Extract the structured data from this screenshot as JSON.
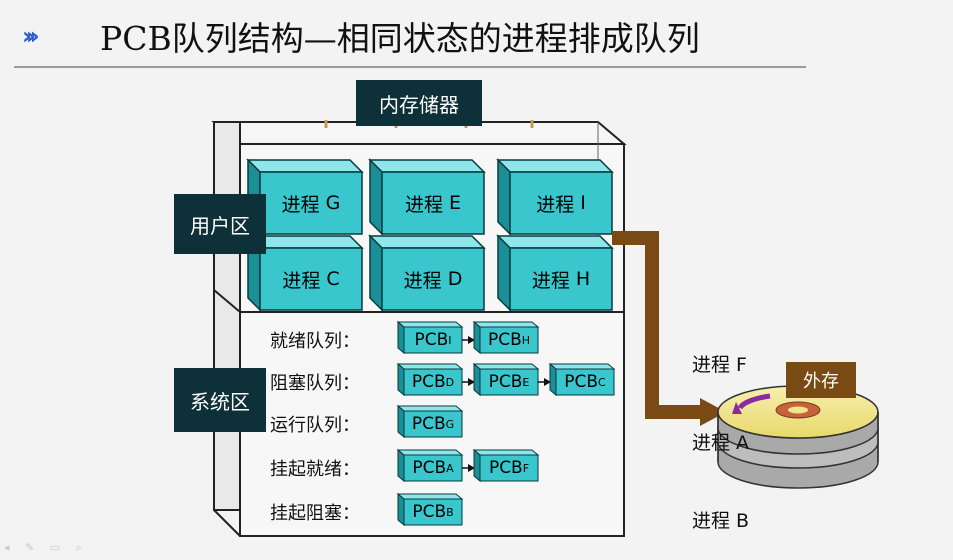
{
  "title": "PCB队列结构—相同状态的进程排成队列",
  "chevron_glyph": "›››",
  "memory_label": "内存储器",
  "user_area_label": "用户区",
  "system_area_label": "系统区",
  "processes": [
    {
      "name": "进程",
      "id": "G"
    },
    {
      "name": "进程",
      "id": "E"
    },
    {
      "name": "进程",
      "id": "I"
    },
    {
      "name": "进程",
      "id": "C"
    },
    {
      "name": "进程",
      "id": "D"
    },
    {
      "name": "进程",
      "id": "H"
    }
  ],
  "queues": [
    {
      "label": "就绪队列：",
      "pcbs": [
        {
          "text": "PCB",
          "sub": "I"
        },
        {
          "text": "PCB",
          "sub": "H"
        }
      ]
    },
    {
      "label": "阻塞队列：",
      "pcbs": [
        {
          "text": "PCB",
          "sub": "D"
        },
        {
          "text": "PCB",
          "sub": "E"
        },
        {
          "text": "PCB",
          "sub": "C"
        }
      ]
    },
    {
      "label": "运行队列：",
      "pcbs": [
        {
          "text": "PCB",
          "sub": "G"
        }
      ]
    },
    {
      "label": "挂起就绪：",
      "pcbs": [
        {
          "text": "PCB",
          "sub": "A"
        },
        {
          "text": "PCB",
          "sub": "F"
        }
      ]
    },
    {
      "label": "挂起阻塞：",
      "pcbs": [
        {
          "text": "PCB",
          "sub": "B"
        }
      ]
    }
  ],
  "external_processes": [
    "进程 F",
    "进程 A",
    "进程 B"
  ],
  "external_storage_label": "外存",
  "colors": {
    "cube_front": "#39c6cc",
    "cube_top": "#8ee6ea",
    "cube_side": "#1b8f96",
    "dark_label": "#0e3038",
    "arrow": "#7a4a14",
    "disk_top": "#f1e58e",
    "disk_side": "#a9a9a9"
  }
}
